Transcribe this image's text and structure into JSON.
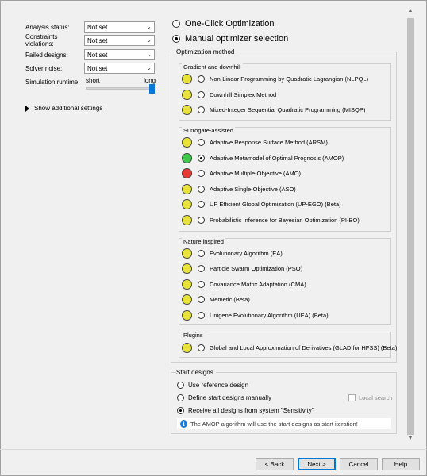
{
  "criteria": [
    {
      "label": "Analysis status:",
      "value": "Not set"
    },
    {
      "label": "Constraints violations:",
      "value": "Not set"
    },
    {
      "label": "Failed designs:",
      "value": "Not set"
    },
    {
      "label": "Solver noise:",
      "value": "Not set"
    }
  ],
  "runtime": {
    "label": "Simulation runtime:",
    "short": "short",
    "long": "long",
    "level": 1.0
  },
  "show_additional": "Show additional settings",
  "mode": {
    "one_click": "One-Click Optimization",
    "manual": "Manual optimizer selection",
    "selected": "manual"
  },
  "optimization_method": {
    "title": "Optimization method",
    "categories": [
      {
        "title": "Gradient and downhill",
        "items": [
          {
            "label": "Non-Linear Programming by Quadratic Lagrangian (NLPQL)",
            "lamp": "yellow",
            "selected": false
          },
          {
            "label": "Downhill Simplex Method",
            "lamp": "yellow",
            "selected": false
          },
          {
            "label": "Mixed-Integer Sequential Quadratic Programming (MISQP)",
            "lamp": "yellow",
            "selected": false
          }
        ]
      },
      {
        "title": "Surrogate-assisted",
        "items": [
          {
            "label": "Adaptive Response Surface Method (ARSM)",
            "lamp": "yellow",
            "selected": false
          },
          {
            "label": "Adaptive Metamodel of Optimal Prognosis (AMOP)",
            "lamp": "green",
            "selected": true
          },
          {
            "label": "Adaptive Multiple-Objective (AMO)",
            "lamp": "red",
            "selected": false
          },
          {
            "label": "Adaptive Single-Objective (ASO)",
            "lamp": "yellow",
            "selected": false
          },
          {
            "label": "UP Efficient Global Optimization (UP-EGO) (Beta)",
            "lamp": "yellow",
            "selected": false
          },
          {
            "label": "Probabilistic Inference for Bayesian Optimization (PI-BO)",
            "lamp": "yellow",
            "selected": false
          }
        ]
      },
      {
        "title": "Nature inspired",
        "items": [
          {
            "label": "Evolutionary Algorithm (EA)",
            "lamp": "yellow",
            "selected": false
          },
          {
            "label": "Particle Swarm Optimization (PSO)",
            "lamp": "yellow",
            "selected": false
          },
          {
            "label": "Covariance Matrix Adaptation (CMA)",
            "lamp": "yellow",
            "selected": false
          },
          {
            "label": "Memetic (Beta)",
            "lamp": "yellow",
            "selected": false
          },
          {
            "label": "Unigene Evolutionary Algorithm (UEA) (Beta)",
            "lamp": "yellow",
            "selected": false
          }
        ]
      },
      {
        "title": "Plugins",
        "items": [
          {
            "label": "Global and Local Approximation of Derivatives (GLAD for HFSS) (Beta)",
            "lamp": "yellow",
            "selected": false
          }
        ]
      }
    ]
  },
  "start_designs": {
    "title": "Start designs",
    "options": [
      {
        "label": "Use reference design",
        "selected": false
      },
      {
        "label": "Define start designs manually",
        "selected": false
      },
      {
        "label": "Receive all designs from system \"Sensitivity\"",
        "selected": true
      }
    ],
    "local_search": "Local search",
    "info": "The AMOP algorithm will use the start designs as start iteration!"
  },
  "buttons": {
    "back": "< Back",
    "next": "Next >",
    "cancel": "Cancel",
    "help": "Help"
  },
  "colors": {
    "yellow": "#e8e23a",
    "green": "#3ec94c",
    "red": "#e33b35",
    "accent": "#0a78d7"
  }
}
